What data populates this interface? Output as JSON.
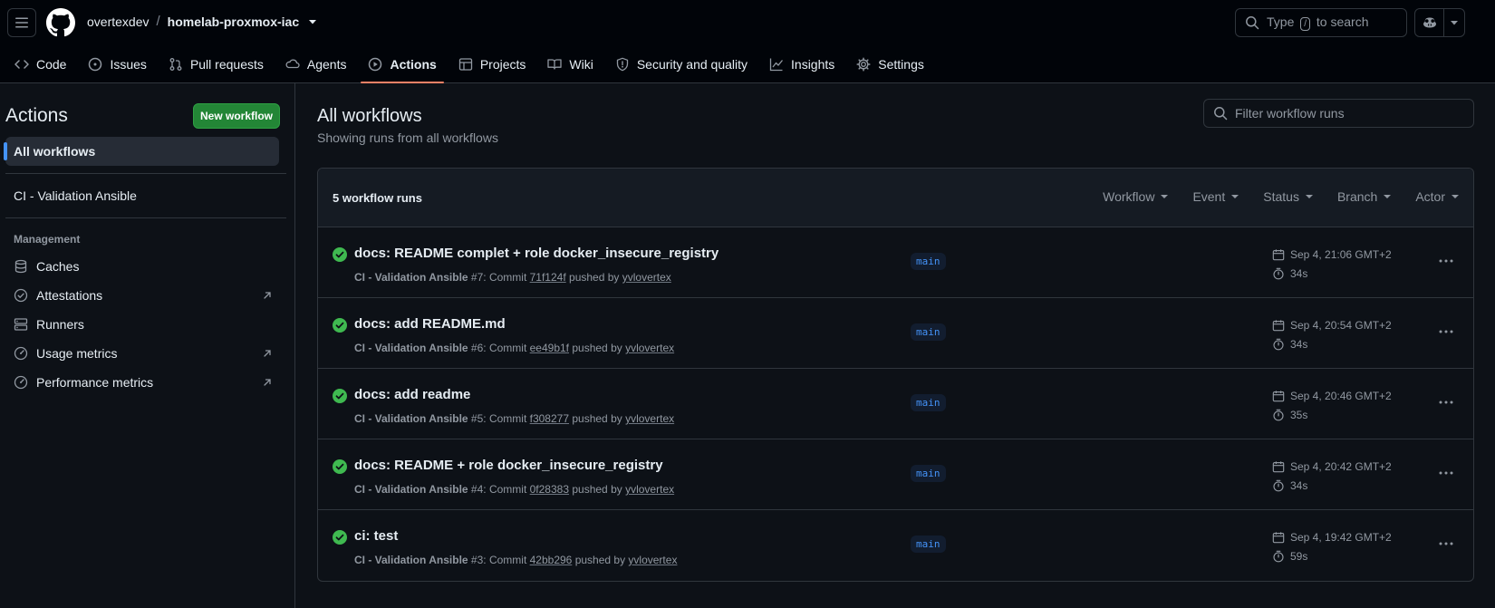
{
  "header": {
    "owner": "overtexdev",
    "separator": "/",
    "repo": "homelab-proxmox-iac",
    "search_prefix": "Type",
    "search_key": "/",
    "search_suffix": "to search"
  },
  "nav": {
    "items": [
      {
        "label": "Code",
        "icon": "code-icon"
      },
      {
        "label": "Issues",
        "icon": "issue-opened-icon"
      },
      {
        "label": "Pull requests",
        "icon": "git-pull-request-icon"
      },
      {
        "label": "Agents",
        "icon": "agent-icon"
      },
      {
        "label": "Actions",
        "icon": "play-icon",
        "active": true
      },
      {
        "label": "Projects",
        "icon": "table-icon"
      },
      {
        "label": "Wiki",
        "icon": "book-icon"
      },
      {
        "label": "Security and quality",
        "icon": "shield-icon"
      },
      {
        "label": "Insights",
        "icon": "graph-icon"
      },
      {
        "label": "Settings",
        "icon": "gear-icon"
      }
    ]
  },
  "sidebar": {
    "title": "Actions",
    "new_workflow": "New workflow",
    "all_workflows": "All workflows",
    "workflow": "CI - Validation Ansible",
    "section_label": "Management",
    "links": [
      {
        "label": "Caches",
        "icon": "database-icon",
        "external": false
      },
      {
        "label": "Attestations",
        "icon": "verified-icon",
        "external": true
      },
      {
        "label": "Runners",
        "icon": "server-icon",
        "external": false
      },
      {
        "label": "Usage metrics",
        "icon": "meter-icon",
        "external": true
      },
      {
        "label": "Performance metrics",
        "icon": "meter-icon",
        "external": true
      }
    ]
  },
  "main": {
    "title": "All workflows",
    "subtitle": "Showing runs from all workflows",
    "filter_placeholder": "Filter workflow runs",
    "runs_count": "5 workflow runs",
    "filters": [
      "Workflow",
      "Event",
      "Status",
      "Branch",
      "Actor"
    ]
  },
  "runs": [
    {
      "title": "docs: README complet + role docker_insecure_registry",
      "workflow": "CI - Validation Ansible",
      "number": "#7",
      "commit_word": ": Commit",
      "commit": "71f124f",
      "pushed_by": "pushed by",
      "user": "yvlovertex",
      "branch": "main",
      "date": "Sep 4, 21:06 GMT+2",
      "duration": "34s",
      "status": "success"
    },
    {
      "title": "docs: add README.md",
      "workflow": "CI - Validation Ansible",
      "number": "#6",
      "commit_word": ": Commit",
      "commit": "ee49b1f",
      "pushed_by": "pushed by",
      "user": "yvlovertex",
      "branch": "main",
      "date": "Sep 4, 20:54 GMT+2",
      "duration": "34s",
      "status": "success"
    },
    {
      "title": "docs: add readme",
      "workflow": "CI - Validation Ansible",
      "number": "#5",
      "commit_word": ": Commit",
      "commit": "f308277",
      "pushed_by": "pushed by",
      "user": "yvlovertex",
      "branch": "main",
      "date": "Sep 4, 20:46 GMT+2",
      "duration": "35s",
      "status": "success"
    },
    {
      "title": "docs: README + role docker_insecure_registry",
      "workflow": "CI - Validation Ansible",
      "number": "#4",
      "commit_word": ": Commit",
      "commit": "0f28383",
      "pushed_by": "pushed by",
      "user": "yvlovertex",
      "branch": "main",
      "date": "Sep 4, 20:42 GMT+2",
      "duration": "34s",
      "status": "success"
    },
    {
      "title": "ci: test",
      "workflow": "CI - Validation Ansible",
      "number": "#3",
      "commit_word": ": Commit",
      "commit": "42bb296",
      "pushed_by": "pushed by",
      "user": "yvlovertex",
      "branch": "main",
      "date": "Sep 4, 19:42 GMT+2",
      "duration": "59s",
      "status": "success"
    }
  ],
  "colors": {
    "bg": "#0d1117",
    "header_bg": "#010409",
    "border": "#30363d",
    "success": "#3fb950",
    "accent": "#4493f8",
    "tab_underline": "#f78166",
    "button_green": "#238636"
  }
}
